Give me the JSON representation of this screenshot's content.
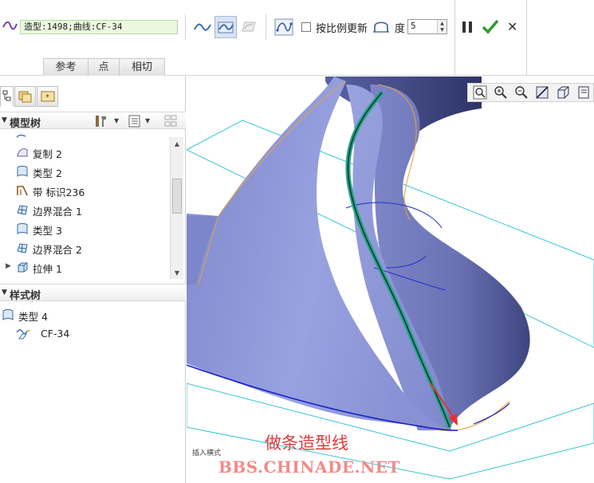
{
  "dashboard": {
    "feature_field": "造型:1498;曲线:CF-34",
    "proportional_update_label": "按比例更新",
    "degree_label": "度",
    "degree_value": "5",
    "tabs": [
      {
        "label": "参考"
      },
      {
        "label": "点"
      },
      {
        "label": "相切"
      }
    ]
  },
  "model_tree": {
    "title": "模型树",
    "items": [
      {
        "label": "复制 2",
        "icon": "copy-surface-icon"
      },
      {
        "label": "类型 2",
        "icon": "style-feature-icon"
      },
      {
        "label": "带 标识236",
        "icon": "ribbon-icon"
      },
      {
        "label": "边界混合 1",
        "icon": "boundary-blend-icon"
      },
      {
        "label": "类型 3",
        "icon": "style-feature-icon"
      },
      {
        "label": "边界混合 2",
        "icon": "boundary-blend-icon"
      },
      {
        "label": "拉伸 1",
        "icon": "extrude-icon"
      }
    ]
  },
  "style_tree": {
    "title": "样式树",
    "items": [
      {
        "label": "类型 4",
        "icon": "style-feature-icon"
      },
      {
        "label": "CF-34",
        "icon": "curve-icon"
      }
    ]
  },
  "viewport": {
    "status_text": "插入横式",
    "caption": "做条造型线",
    "watermark": "BBS.CHINADE.NET"
  },
  "colors": {
    "surface": "#8e98d8",
    "surface_dark": "#4a5290",
    "datum_plane": "#35c4d8",
    "edge": "#e8a33a",
    "curve": "#2aa48a",
    "caption": "#e03a3a"
  }
}
